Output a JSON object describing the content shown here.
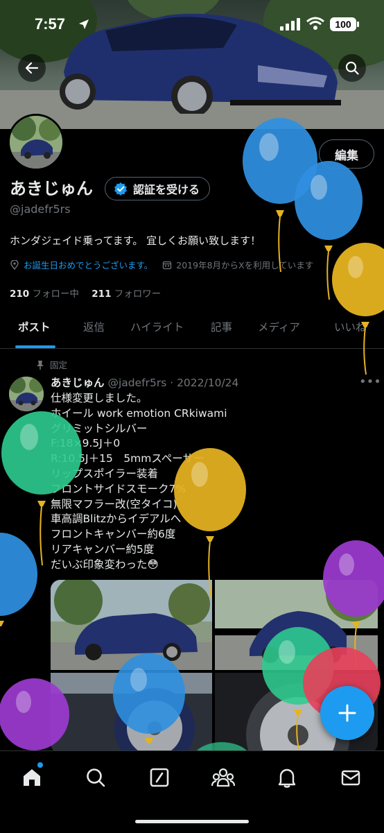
{
  "status_bar": {
    "time": "7:57",
    "battery": "100"
  },
  "profile": {
    "edit_label": "編集",
    "name": "あきじゅん",
    "verify_label": "認証を受ける",
    "handle": "@jadefr5rs",
    "bio": "ホンダジェイド乗ってます。 宜しくお願い致します！",
    "birthday_text": "お誕生日おめでとうございます。",
    "joined_text": "2019年8月からXを利用しています",
    "following_count": "210",
    "following_label": "フォロー中",
    "followers_count": "211",
    "followers_label": "フォロワー"
  },
  "tabs": [
    {
      "label": "ポスト",
      "active": true
    },
    {
      "label": "返信"
    },
    {
      "label": "ハイライト"
    },
    {
      "label": "記事"
    },
    {
      "label": "メディア"
    },
    {
      "label": "いいね"
    }
  ],
  "pinned_post": {
    "pinned_label": "固定",
    "author_name": "あきじゅん",
    "author_handle": "@jadefr5rs",
    "date": "2022/10/24",
    "lines": [
      "仕様変更しました。",
      "ホイール work emotion CRkiwami",
      "グリミットシルバー",
      "F:18×9.5J＋0",
      "R:10.5J＋15　5mmスペーサー",
      "リップスポイラー装着",
      "フロントサイドスモーク7%",
      "無限マフラー改(空タイコ)",
      "車高調Blitzからイデアルへ",
      "フロントキャンバー約6度",
      "リアキャンバー約5度",
      "だいぶ印象変わった😳"
    ]
  },
  "colors": {
    "accent": "#1d9bf0",
    "balloon_blue": "#2f8fe0",
    "balloon_yellow": "#e6b320",
    "balloon_green": "#2ecc8f",
    "balloon_purple": "#9b3ad0",
    "balloon_red": "#e8405a"
  },
  "nav_icons": [
    "home-icon",
    "search-icon",
    "grok-icon",
    "communities-icon",
    "notifications-icon",
    "messages-icon"
  ]
}
